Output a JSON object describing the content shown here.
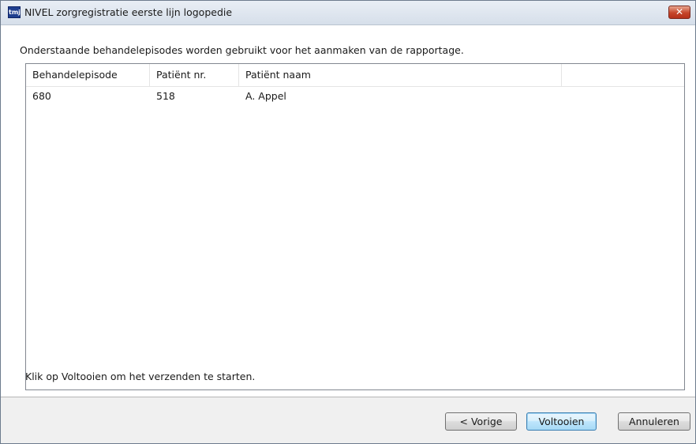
{
  "window": {
    "title": "NIVEL zorgregistratie eerste lijn logopedie",
    "icon_text": "tmj",
    "close_label": "✕"
  },
  "main": {
    "intro": "Onderstaande behandelepisodes worden gebruikt voor het aanmaken van de rapportage.",
    "columns": [
      "Behandelepisode",
      "Patiënt nr.",
      "Patiënt naam"
    ],
    "rows": [
      [
        "680",
        "518",
        "A. Appel"
      ]
    ],
    "status": "Klik op Voltooien om het verzenden te starten."
  },
  "buttons": {
    "back": "< Vorige",
    "finish": "Voltooien",
    "cancel": "Annuleren"
  },
  "colors": {
    "titlebar": "#dbe4ef",
    "close": "#c6462a",
    "default_button_border": "#3c7fb1"
  }
}
